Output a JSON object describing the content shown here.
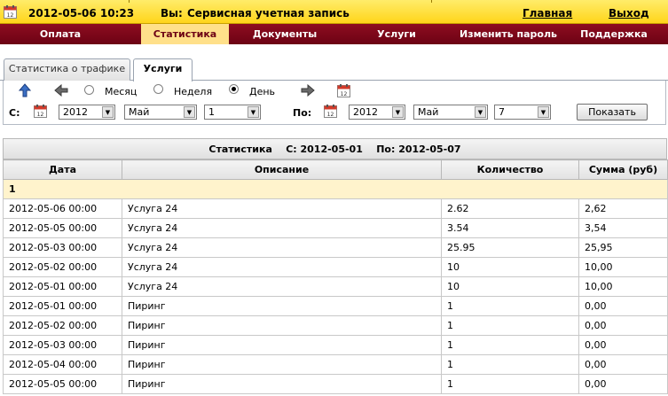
{
  "header": {
    "datetime": "2012-05-06 10:23",
    "user_label": "Вы:",
    "user_name": "Сервисная учетная запись",
    "home_link": "Главная",
    "logout_link": "Выход"
  },
  "menu": {
    "items": [
      "Оплата",
      "Статистика",
      "Документы",
      "Услуги",
      "Изменить пароль",
      "Поддержка"
    ],
    "active": "Статистика"
  },
  "subtabs": {
    "items": [
      "Статистика о трафике",
      "Услуги"
    ],
    "active": "Услуги"
  },
  "filter": {
    "period_options": [
      "Месяц",
      "Неделя",
      "День"
    ],
    "selected_period": "День",
    "from_label": "С:",
    "to_label": "По:",
    "from": {
      "year": "2012",
      "month": "Май",
      "day": "1"
    },
    "to": {
      "year": "2012",
      "month": "Май",
      "day": "7"
    },
    "show_button": "Показать"
  },
  "table": {
    "title": "Статистика",
    "title_from": "С: 2012-05-01",
    "title_to": "По: 2012-05-07",
    "columns": [
      "Дата",
      "Описание",
      "Количество",
      "Сумма (руб)"
    ],
    "group_label": "1",
    "rows": [
      [
        "2012-05-06 00:00",
        "Услуга 24",
        "2.62",
        "2,62"
      ],
      [
        "2012-05-05 00:00",
        "Услуга 24",
        "3.54",
        "3,54"
      ],
      [
        "2012-05-03 00:00",
        "Услуга 24",
        "25.95",
        "25,95"
      ],
      [
        "2012-05-02 00:00",
        "Услуга 24",
        "10",
        "10,00"
      ],
      [
        "2012-05-01 00:00",
        "Услуга 24",
        "10",
        "10,00"
      ],
      [
        "2012-05-01 00:00",
        "Пиринг",
        "1",
        "0,00"
      ],
      [
        "2012-05-02 00:00",
        "Пиринг",
        "1",
        "0,00"
      ],
      [
        "2012-05-03 00:00",
        "Пиринг",
        "1",
        "0,00"
      ],
      [
        "2012-05-04 00:00",
        "Пиринг",
        "1",
        "0,00"
      ],
      [
        "2012-05-05 00:00",
        "Пиринг",
        "1",
        "0,00"
      ]
    ]
  },
  "icons": {
    "calendar": "calendar-icon",
    "up": "arrow-up-icon",
    "prev": "arrow-left-icon",
    "next": "arrow-right-icon"
  },
  "colors": {
    "topbar": "#ffd51a",
    "menubar": "#7d0819",
    "menu_active": "#ffe08a",
    "group_row": "#fff3cc"
  }
}
